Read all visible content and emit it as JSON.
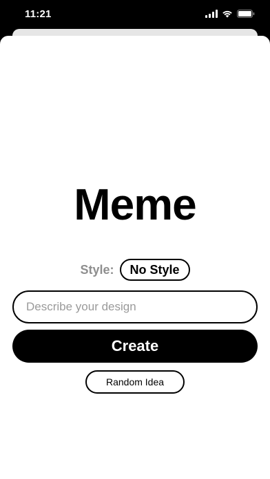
{
  "status_bar": {
    "time": "11:21",
    "icons": [
      "cellular-signal-icon",
      "wifi-icon",
      "battery-icon"
    ]
  },
  "main": {
    "title": "Meme",
    "style": {
      "label": "Style:",
      "selected": "No Style"
    },
    "prompt_input": {
      "value": "",
      "placeholder": "Describe your design"
    },
    "create_label": "Create",
    "random_idea_label": "Random Idea"
  },
  "colors": {
    "background": "#000000",
    "sheet": "#ffffff",
    "primary": "#000000",
    "muted_label": "#8e8e8e",
    "placeholder": "#9a9a9a"
  }
}
